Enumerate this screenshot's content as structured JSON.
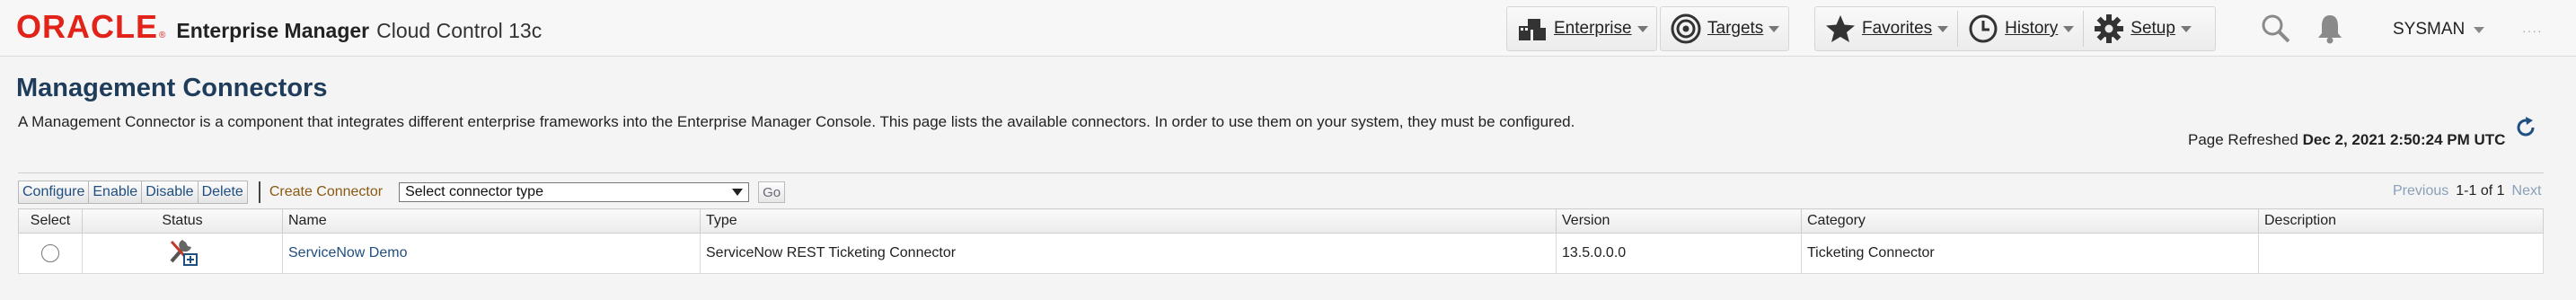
{
  "header": {
    "logo": "ORACLE",
    "product": "Enterprise Manager",
    "product_sub": "Cloud Control 13c",
    "nav": {
      "enterprise": "Enterprise",
      "targets": "Targets",
      "favorites": "Favorites",
      "history": "History",
      "setup": "Setup"
    },
    "user": "SYSMAN"
  },
  "page": {
    "title": "Management Connectors",
    "description": "A Management Connector is a component that integrates different enterprise frameworks into the Enterprise Manager Console. This page lists the available connectors. In order to use them on your system, they must be configured.",
    "refresh_label": "Page Refreshed",
    "refresh_time": "Dec 2, 2021 2:50:24 PM UTC"
  },
  "toolbar": {
    "configure": "Configure",
    "enable": "Enable",
    "disable": "Disable",
    "delete": "Delete",
    "create_connector": "Create Connector",
    "select_value": "Select connector type",
    "go": "Go"
  },
  "pager": {
    "previous": "Previous",
    "range": "1-1 of 1",
    "next": "Next"
  },
  "table": {
    "columns": [
      "Select",
      "Status",
      "Name",
      "Type",
      "Version",
      "Category",
      "Description"
    ],
    "rows": [
      {
        "status_icon": "configure-tool-icon",
        "name": "ServiceNow Demo",
        "type": "ServiceNow REST Ticketing Connector",
        "version": "13.5.0.0.0",
        "category": "Ticketing Connector",
        "description": ""
      }
    ]
  }
}
